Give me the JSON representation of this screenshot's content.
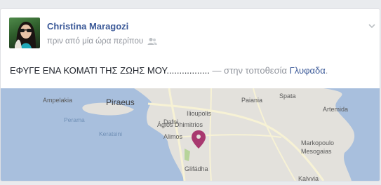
{
  "post": {
    "author": "Christina Maragozi",
    "time": "πριν από μία ώρα περίπου",
    "audience_icon": "friends-icon",
    "status_text": "ΕΦΥΓΕ ΕΝΑ ΚΟΜΑΤΙ ΤΗΣ ΖΩΗΣ ΜΟΥ.................",
    "location_prefix": " — στην τοποθεσία ",
    "location_name": "Γλυφαδα",
    "location_suffix": "."
  },
  "map": {
    "labels": {
      "piraeus": "Piraeus",
      "ampelakia": "Ampelakia",
      "perama": "Perama",
      "keratsini": "Keratsini",
      "ilioupolis": "Ilioupolis",
      "dafni": "Dafni",
      "agios_dimitrios": "Ágios Dhimitrios",
      "alimos": "Alimos",
      "glyfada": "Glifádha",
      "paiania": "Paiania",
      "spata": "Spata",
      "artemida": "Artemida",
      "markopoulo": "Markopoulo Mesogaias",
      "kalyvia": "Kalyvia"
    },
    "colors": {
      "land": "#e3e1dc",
      "water": "#a8bfdd",
      "road": "#f7f2d5",
      "pin": "#a8386f"
    }
  },
  "colors": {
    "link": "#3b5998",
    "muted": "#90949c",
    "text": "#1d2129"
  }
}
